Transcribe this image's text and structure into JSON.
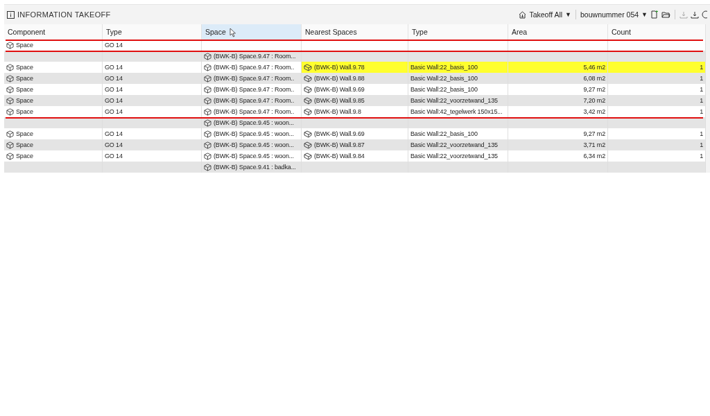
{
  "panel": {
    "title": "INFORMATION TAKEOFF"
  },
  "toolbar": {
    "takeoff": "Takeoff All",
    "caret_1": "▼",
    "project": "bouwnummer 054",
    "caret_2": "▼"
  },
  "table": {
    "columns": [
      {
        "label": "Component",
        "selected": false
      },
      {
        "label": "Type",
        "selected": false
      },
      {
        "label": "Space",
        "selected": true
      },
      {
        "label": "Nearest Spaces",
        "selected": false
      },
      {
        "label": "Type",
        "selected": false
      },
      {
        "label": "Area",
        "selected": false
      },
      {
        "label": "Count",
        "selected": false
      }
    ],
    "rows": [
      {
        "struck": true,
        "highlighted": false,
        "cells": [
          "Space",
          "GO 14",
          "",
          "",
          "",
          "",
          ""
        ]
      },
      {
        "struck": true,
        "highlighted": false,
        "cells": [
          "",
          "",
          "(BWK-B) Space.9.47 : Room...",
          "",
          "",
          "",
          ""
        ]
      },
      {
        "struck": false,
        "highlighted": true,
        "cells": [
          "Space",
          "GO 14",
          "(BWK-B) Space.9.47 : Room..",
          "(BWK-B) Wall.9.78",
          "Basic Wall:22_basis_100",
          "5,46 m2",
          "1"
        ]
      },
      {
        "struck": false,
        "highlighted": false,
        "cells": [
          "Space",
          "GO 14",
          "(BWK-B) Space.9.47 : Room..",
          "(BWK-B) Wall.9.88",
          "Basic Wall:22_basis_100",
          "6,08 m2",
          "1"
        ]
      },
      {
        "struck": false,
        "highlighted": false,
        "cells": [
          "Space",
          "GO 14",
          "(BWK-B) Space.9.47 : Room..",
          "(BWK-B) Wall.9.69",
          "Basic Wall:22_basis_100",
          "9,27 m2",
          "1"
        ]
      },
      {
        "struck": false,
        "highlighted": false,
        "cells": [
          "Space",
          "GO 14",
          "(BWK-B) Space.9.47 : Room..",
          "(BWK-B) Wall.9.85",
          "Basic Wall:22_voorzetwand_135",
          "7,20 m2",
          "1"
        ]
      },
      {
        "struck": false,
        "highlighted": false,
        "cells": [
          "Space",
          "GO 14",
          "(BWK-B) Space.9.47 : Room..",
          "(BWK-B) Wall.9.8",
          "Basic Wall:42_tegelwerk 150x15...",
          "3,42 m2",
          "1"
        ]
      },
      {
        "struck": true,
        "highlighted": false,
        "cells": [
          "",
          "",
          "(BWK-B) Space.9.45 : woon...",
          "",
          "",
          "",
          ""
        ]
      },
      {
        "struck": false,
        "highlighted": false,
        "cells": [
          "Space",
          "GO 14",
          "(BWK-B) Space.9.45 : woon...",
          "(BWK-B) Wall.9.69",
          "Basic Wall:22_basis_100",
          "9,27 m2",
          "1"
        ]
      },
      {
        "struck": false,
        "highlighted": false,
        "cells": [
          "Space",
          "GO 14",
          "(BWK-B) Space.9.45 : woon...",
          "(BWK-B) Wall.9.87",
          "Basic Wall:22_voorzetwand_135",
          "3,71 m2",
          "1"
        ]
      },
      {
        "struck": false,
        "highlighted": false,
        "cells": [
          "Space",
          "GO 14",
          "(BWK-B) Space.9.45 : woon...",
          "(BWK-B) Wall.9.84",
          "Basic Wall:22_voorzetwand_135",
          "6,34 m2",
          "1"
        ]
      },
      {
        "struck": false,
        "highlighted": false,
        "cells": [
          "",
          "",
          "(BWK-B) Space.9.41 : badka...",
          "",
          "",
          "",
          ""
        ]
      }
    ]
  }
}
